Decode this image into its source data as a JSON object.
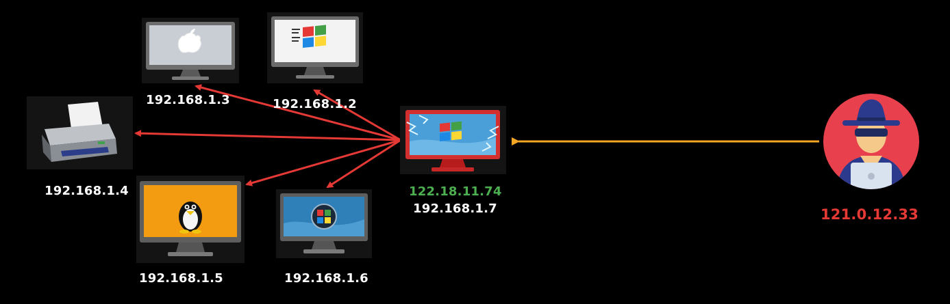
{
  "nodes": {
    "mac": {
      "ip": "192.168.1.3",
      "icon": "apple-monitor-icon"
    },
    "win98": {
      "ip": "192.168.1.2",
      "icon": "windows-classic-monitor-icon"
    },
    "printer": {
      "ip": "192.168.1.4",
      "icon": "printer-icon"
    },
    "linux": {
      "ip": "192.168.1.5",
      "icon": "linux-tux-monitor-icon"
    },
    "win7": {
      "ip": "192.168.1.6",
      "icon": "windows-vista-monitor-icon"
    },
    "gateway": {
      "public_ip": "122.18.11.74",
      "local_ip": "192.168.1.7",
      "icon": "compromised-windows-monitor-icon"
    },
    "attacker": {
      "ip": "121.0.12.33",
      "icon": "hacker-avatar-icon"
    }
  },
  "colors": {
    "background": "#000000",
    "lan_arrow": "#e53935",
    "attack_arrow": "#f5a623",
    "public_ip": "#4caf50",
    "attacker_ip": "#e53935"
  }
}
